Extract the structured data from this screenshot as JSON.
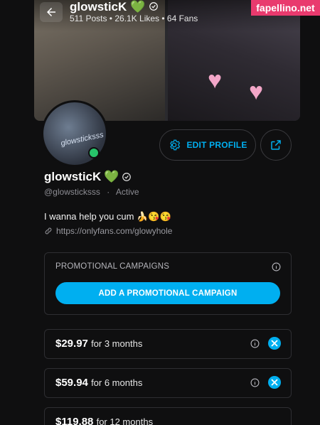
{
  "watermark": "fapellino.net",
  "header": {
    "title": "glowsticK",
    "stats": "511 Posts • 26.1K Likes • 64 Fans"
  },
  "avatar": {
    "tag_text": "glowsticksss"
  },
  "profile": {
    "name": "glowsticK",
    "handle": "@glowsticksss",
    "separator": "·",
    "status": "Active",
    "bio": "I wanna help you cum 🍌😘😘",
    "link": "https://onlyfans.com/glowyhole"
  },
  "actions": {
    "edit_profile_label": "EDIT PROFILE"
  },
  "promo": {
    "title": "PROMOTIONAL CAMPAIGNS",
    "button_label": "ADD A PROMOTIONAL CAMPAIGN"
  },
  "bundles": [
    {
      "price": "$29.97",
      "period": "for 3 months"
    },
    {
      "price": "$59.94",
      "period": "for 6 months"
    },
    {
      "price": "$119.88",
      "period": "for 12 months"
    }
  ],
  "colors": {
    "accent": "#00aff0",
    "background": "#0f0f10",
    "online": "#27c36a",
    "watermark_bg": "#e93a6e"
  },
  "icons": [
    "back-arrow-icon",
    "heart-emoji-icon",
    "verified-icon",
    "gear-icon",
    "share-icon",
    "link-icon",
    "info-icon",
    "close-icon"
  ]
}
